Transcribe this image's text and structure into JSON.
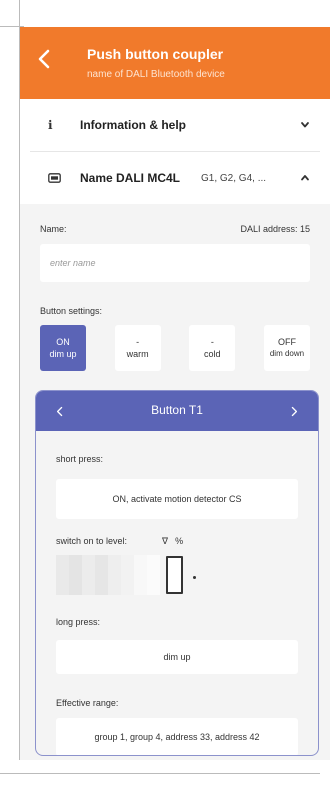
{
  "header": {
    "title": "Push button coupler",
    "subtitle": "name of DALI Bluetooth device"
  },
  "rows": {
    "info": {
      "icon": "info-icon",
      "label": "Information & help"
    },
    "device": {
      "icon": "card-icon",
      "label": "Name DALI MC4L",
      "extra": "G1, G2, G4, ..."
    }
  },
  "form": {
    "name_label": "Name:",
    "dali_address": "DALI address: 15",
    "name_placeholder": "enter name",
    "button_settings_label": "Button settings:"
  },
  "button_settings": [
    {
      "line1": "ON",
      "line2": "dim up",
      "active": true
    },
    {
      "line1": "-",
      "line2": "warm",
      "active": false
    },
    {
      "line1": "-",
      "line2": "cold",
      "active": false
    },
    {
      "line1": "OFF",
      "line2": "dim down",
      "active": false
    }
  ],
  "panel": {
    "title": "Button T1",
    "short_press_label": "short press:",
    "short_press_value": "ON, activate motion detector CS",
    "switch_level_label": "switch on to level:",
    "switch_level_symbol": "∇",
    "switch_level_unit": "%",
    "level_segments": [
      "#e9e9e9",
      "#e4e4e4",
      "#ececec",
      "#e6e6e6",
      "#eeeeee",
      "#f2f2f2",
      "#f8f8f8",
      "#fbfbfb"
    ],
    "long_press_label": "long press:",
    "long_press_value": "dim up",
    "effective_range_label": "Effective range:",
    "effective_range_value": "group 1, group 4, address 33, address 42"
  },
  "colors": {
    "accent": "#f17a2b",
    "primary": "#5b64b6"
  }
}
